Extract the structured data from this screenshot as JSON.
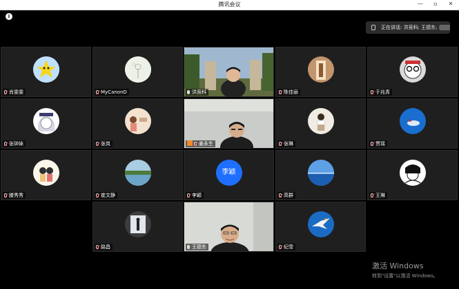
{
  "window": {
    "title": "腾讯会议",
    "controls": [
      "—",
      "▫",
      "✕"
    ]
  },
  "info_icon": "i",
  "speaking": {
    "label": "正在讲话: 洪竞科; 王德东;"
  },
  "tiles": [
    {
      "name": "肖雯雯",
      "mic": "off",
      "avatar": "star-cartoon"
    },
    {
      "name": "MyCanonD",
      "mic": "off",
      "avatar": "dandelion"
    },
    {
      "name": "洪竞科",
      "mic": "on",
      "avatar": "video"
    },
    {
      "name": "陈佳丽",
      "mic": "off",
      "avatar": "corridor"
    },
    {
      "name": "于兆青",
      "mic": "off",
      "avatar": "cartoon-glasses"
    },
    {
      "name": "张钟妹",
      "mic": "off",
      "avatar": "anime-girl"
    },
    {
      "name": "张岚",
      "mic": "off",
      "avatar": "illustration"
    },
    {
      "name": "姜永生",
      "mic": "off",
      "host": true,
      "avatar": "video"
    },
    {
      "name": "张琳",
      "mic": "off",
      "avatar": "girl-photo"
    },
    {
      "name": "贾瑶",
      "mic": "off",
      "avatar": "blue-sky"
    },
    {
      "name": "滕秀秀",
      "mic": "off",
      "avatar": "cartoon-couple"
    },
    {
      "name": "崔文静",
      "mic": "off",
      "avatar": "lake"
    },
    {
      "name": "李颖",
      "mic": "off",
      "avatar": "text",
      "avatar_text": "李颖"
    },
    {
      "name": "高群",
      "mic": "off",
      "avatar": "sea"
    },
    {
      "name": "王琳",
      "mic": "off",
      "avatar": "sketch"
    },
    {
      "name": "路昌",
      "mic": "off",
      "avatar": "window-figure"
    },
    {
      "name": "王德东",
      "mic": "on",
      "avatar": "video"
    },
    {
      "name": "纪雪",
      "mic": "off",
      "avatar": "eagle"
    }
  ],
  "watermark": {
    "line1": "激活 Windows",
    "line2": "转到\"设置\"以激活 Windows。"
  },
  "colors": {
    "tile_bg": "#1f1f1f",
    "accent_blue": "#1e6fff",
    "host_orange": "#f08a24"
  }
}
